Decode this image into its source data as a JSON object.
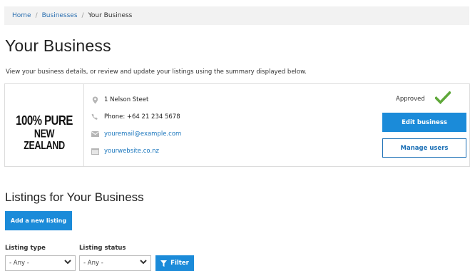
{
  "breadcrumb": {
    "items": [
      "Home",
      "Businesses",
      "Your Business"
    ],
    "separator": "/"
  },
  "page": {
    "title": "Your Business",
    "intro": "View your business details, or review and update your listings using the summary displayed below."
  },
  "business": {
    "logo_line1": "100% PURE",
    "logo_line2": "NEW ZEALAND",
    "address": "1 Nelson Steet",
    "phone": "Phone: +64 21 234 5678",
    "email": "youremail@example.com",
    "website": "yourwebsite.co.nz",
    "status": "Approved",
    "edit_label": "Edit business",
    "manage_label": "Manage users"
  },
  "listings": {
    "title": "Listings for Your Business",
    "add_label": "Add a new listing",
    "type_label": "Listing type",
    "type_value": "- Any -",
    "status_label": "Listing status",
    "status_value": "- Any -",
    "filter_label": "Filter"
  },
  "colors": {
    "accent": "#1b8bd9",
    "link": "#1a76bd",
    "approved": "#5fa83a"
  }
}
